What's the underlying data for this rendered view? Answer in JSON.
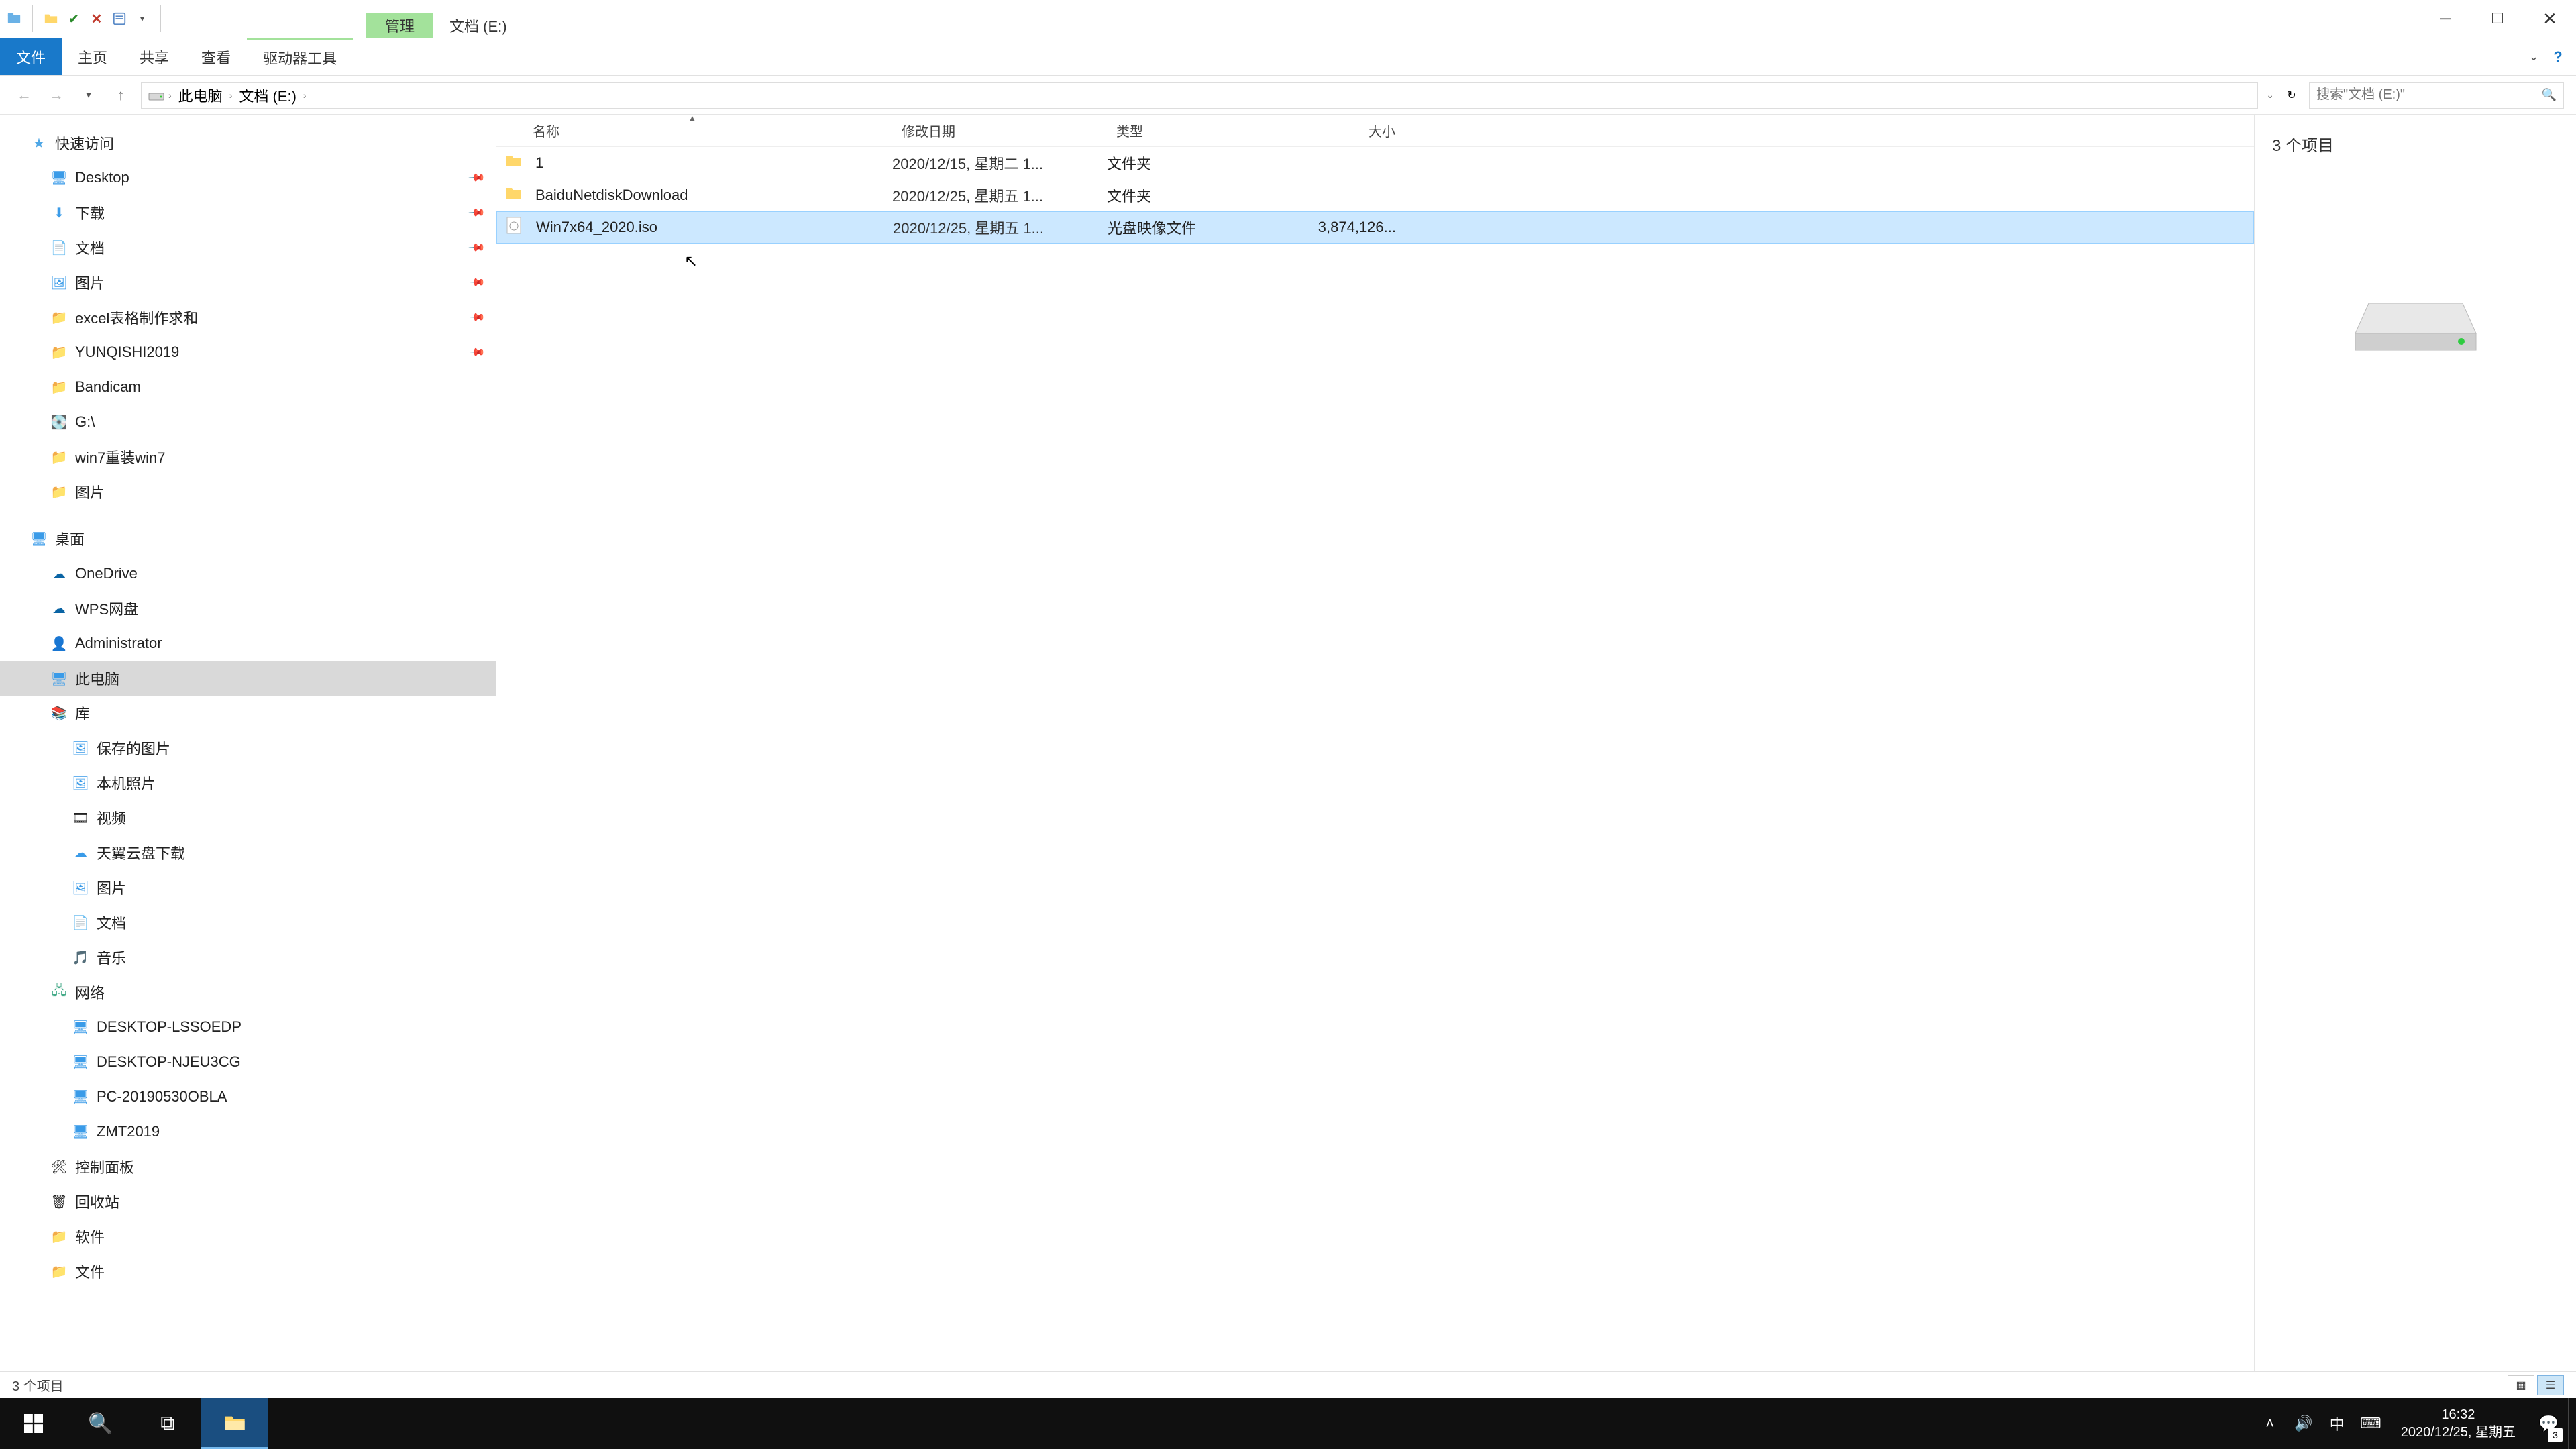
{
  "titlebar": {
    "context_tab": "管理",
    "title": "文档 (E:)"
  },
  "menu": {
    "file": "文件",
    "home": "主页",
    "share": "共享",
    "view": "查看",
    "drive_tools": "驱动器工具"
  },
  "breadcrumbs": {
    "pc": "此电脑",
    "drive": "文档 (E:)"
  },
  "search": {
    "placeholder": "搜索\"文档 (E:)\""
  },
  "nav": {
    "quick_access": "快速访问",
    "desktop": "Desktop",
    "downloads": "下载",
    "documents": "文档",
    "pictures": "图片",
    "excel": "excel表格制作求和",
    "yunqishi": "YUNQISHI2019",
    "bandicam": "Bandicam",
    "g_drive": "G:\\",
    "reinstall": "win7重装win7",
    "pictures2": "图片",
    "desktop_root": "桌面",
    "onedrive": "OneDrive",
    "wps": "WPS网盘",
    "admin": "Administrator",
    "this_pc": "此电脑",
    "libraries": "库",
    "saved_pics": "保存的图片",
    "camera_roll": "本机照片",
    "videos": "视频",
    "tianyi": "天翼云盘下载",
    "pics_lib": "图片",
    "docs_lib": "文档",
    "music": "音乐",
    "network": "网络",
    "pc1": "DESKTOP-LSSOEDP",
    "pc2": "DESKTOP-NJEU3CG",
    "pc3": "PC-20190530OBLA",
    "pc4": "ZMT2019",
    "control_panel": "控制面板",
    "recycle": "回收站",
    "software": "软件",
    "filelib": "文件"
  },
  "columns": {
    "name": "名称",
    "date": "修改日期",
    "type": "类型",
    "size": "大小"
  },
  "files": [
    {
      "name": "1",
      "date": "2020/12/15, 星期二 1...",
      "type": "文件夹",
      "size": "",
      "icon": "folder"
    },
    {
      "name": "BaiduNetdiskDownload",
      "date": "2020/12/25, 星期五 1...",
      "type": "文件夹",
      "size": "",
      "icon": "folder"
    },
    {
      "name": "Win7x64_2020.iso",
      "date": "2020/12/25, 星期五 1...",
      "type": "光盘映像文件",
      "size": "3,874,126...",
      "icon": "iso",
      "selected": true
    }
  ],
  "preview": {
    "label": "3 个项目"
  },
  "status": {
    "text": "3 个项目"
  },
  "tray": {
    "ime": "中"
  },
  "clock": {
    "time": "16:32",
    "date": "2020/12/25, 星期五"
  },
  "notif_count": "3"
}
